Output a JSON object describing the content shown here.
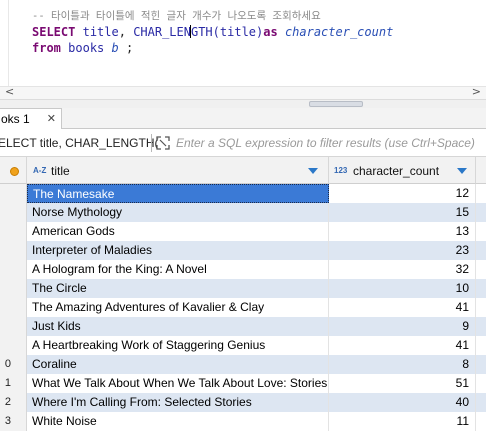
{
  "editor": {
    "comment": "-- 타이틀과 타이틀에 적힌 글자 개수가 나오도록 조회하세요",
    "line2": {
      "kw_select": "SELECT",
      "col_title": "title",
      "comma": ",",
      "func": "CHAR_LEN",
      "func_rest": "GTH",
      "args": "(title)",
      "kw_as": "as",
      "alias": "character_count"
    },
    "line3": {
      "kw_from": "from",
      "table": "books",
      "table_alias": "b",
      "terminator": ";"
    }
  },
  "scrollbar": {
    "left_arrow": "<",
    "right_arrow": ">"
  },
  "tab": {
    "label": "oks 1",
    "close": "✕"
  },
  "filter": {
    "query_label": "ELECT title, CHAR_LENGTH(",
    "placeholder": "Enter a SQL expression to filter results (use Ctrl+Space)"
  },
  "grid": {
    "columns": [
      {
        "type_badge": "A-Z",
        "name": "title"
      },
      {
        "type_badge": "123",
        "name": "character_count"
      }
    ],
    "rows": [
      {
        "rownum": "",
        "title": "The Namesake",
        "count": "12"
      },
      {
        "rownum": "",
        "title": "Norse Mythology",
        "count": "15"
      },
      {
        "rownum": "",
        "title": "American Gods",
        "count": "13"
      },
      {
        "rownum": "",
        "title": "Interpreter of Maladies",
        "count": "23"
      },
      {
        "rownum": "",
        "title": "A Hologram for the King: A Novel",
        "count": "32"
      },
      {
        "rownum": "",
        "title": "The Circle",
        "count": "10"
      },
      {
        "rownum": "",
        "title": "The Amazing Adventures of Kavalier & Clay",
        "count": "41"
      },
      {
        "rownum": "",
        "title": "Just Kids",
        "count": "9"
      },
      {
        "rownum": "",
        "title": "A Heartbreaking Work of Staggering Genius",
        "count": "41"
      },
      {
        "rownum": "0",
        "title": "Coraline",
        "count": "8"
      },
      {
        "rownum": "1",
        "title": "What We Talk About When We Talk About Love: Stories",
        "count": "51"
      },
      {
        "rownum": "2",
        "title": "Where I'm Calling From: Selected Stories",
        "count": "40"
      },
      {
        "rownum": "3",
        "title": "White Noise",
        "count": "11"
      }
    ]
  }
}
